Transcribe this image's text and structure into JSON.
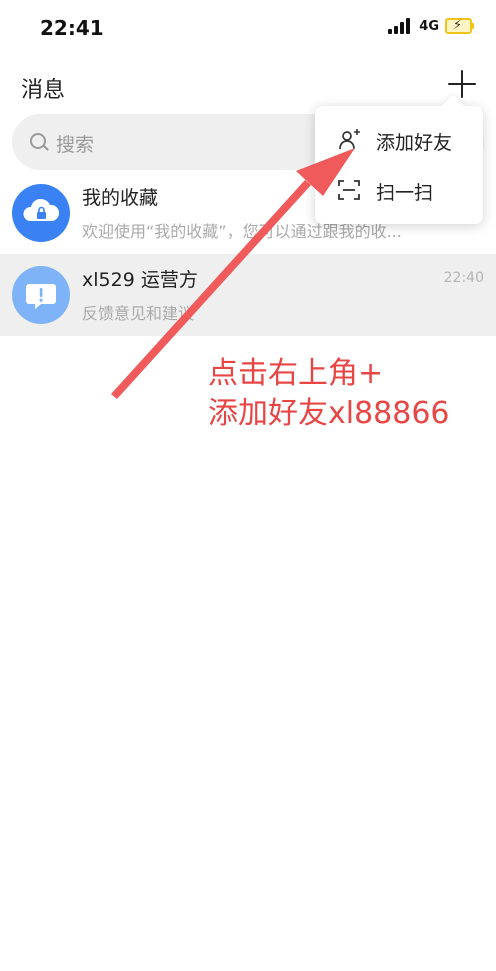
{
  "status_bar": {
    "time": "22:41",
    "network": "4G",
    "battery_icon": "battery-charging-icon",
    "signal_icon": "signal-bars-icon"
  },
  "header": {
    "title": "消息",
    "add_icon": "plus-icon"
  },
  "search": {
    "placeholder": "搜索",
    "icon": "search-icon"
  },
  "chats": [
    {
      "name": "我的收藏",
      "preview": "欢迎使用“我的收藏”，您可以通过跟我的收...",
      "time": "",
      "avatar_icon": "cloud-lock-icon",
      "avatar_color": "#3a82f4"
    },
    {
      "name": "xl529 运营方",
      "preview": "反馈意见和建议",
      "time": "22:40",
      "avatar_icon": "speech-bubble-alert-icon",
      "avatar_color": "#7fb3f8"
    }
  ],
  "popup_menu": {
    "items": [
      {
        "label": "添加好友",
        "icon": "add-friend-icon"
      },
      {
        "label": "扫一扫",
        "icon": "scan-icon"
      }
    ]
  },
  "annotation": {
    "text": "点击右上角+\n添加好友xl88866",
    "color": "#e84545"
  },
  "colors": {
    "accent_blue": "#3a82f4",
    "annotation_red": "#e84545",
    "row_highlight": "#efefef"
  }
}
